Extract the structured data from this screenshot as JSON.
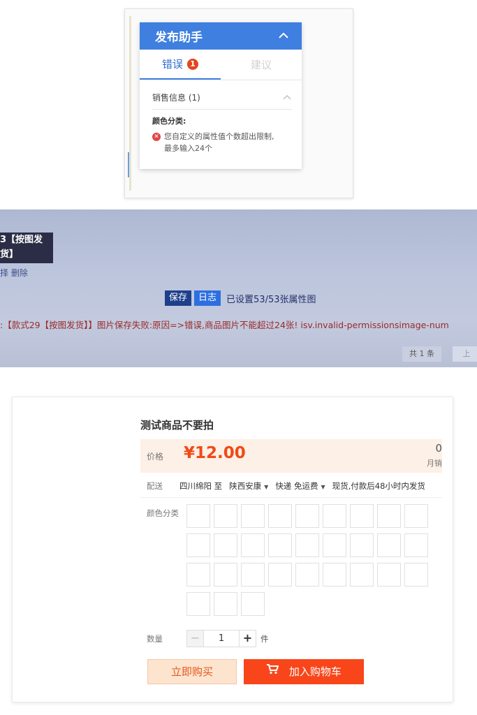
{
  "panel1": {
    "title": "发布助手",
    "collapse_icon": "chevron-up-icon",
    "tabs": [
      {
        "label": "错误",
        "badge": "1",
        "active": true
      },
      {
        "label": "建议",
        "active": false
      }
    ],
    "section": {
      "label": "销售信息 (1)",
      "collapse_icon": "chevron-up-icon"
    },
    "field_label": "颜色分类:",
    "error_icon": "error-circle-icon",
    "error_line1": "您自定义的属性值个数超出限制,",
    "error_line2": "最多输入24个",
    "colors": {
      "header": "#3f7fe0",
      "badge": "#e2461f"
    }
  },
  "panel2": {
    "box_line1": "3【按图发",
    "box_line2": "货】",
    "links": "择 删除",
    "save_button": "保存",
    "log_button": "日志",
    "status": "已设置53/53张属性图",
    "error": ":【款式29【按图发货】】图片保存失败:原因=>错误,商品图片不能超过24张! isv.invalid-permissionsimage-num",
    "pager": "共 1 条",
    "next": "上"
  },
  "product": {
    "title": "测试商品不要拍",
    "price_label": "价格",
    "price": "¥12.00",
    "sales_count": "0",
    "sales_label": "月销",
    "shipping_label": "配送",
    "ship_from": "四川绵阳 至",
    "ship_to": "陕西安康",
    "ship_method": "快递 免运费",
    "ship_note": "现货,付款后48小时内发货",
    "color_label": "颜色分类",
    "swatch_count": 30,
    "qty_label": "数量",
    "qty_minus": "−",
    "qty_value": "1",
    "qty_plus": "+",
    "qty_unit": "件",
    "buy_now": "立即购买",
    "add_to_cart": "加入购物车",
    "cart_icon": "shopping-cart-icon",
    "colors": {
      "price": "#f04a17",
      "cart_button": "#f8461a",
      "buy_button_bg": "#fde4cf"
    }
  }
}
